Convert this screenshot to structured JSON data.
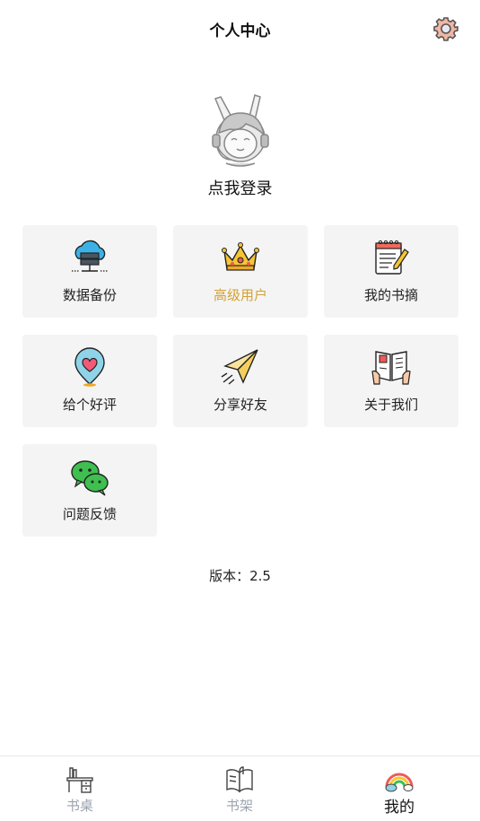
{
  "header": {
    "title": "个人中心",
    "settings_icon": "gear-icon"
  },
  "profile": {
    "login_text": "点我登录",
    "avatar_icon": "cartoon-avatar"
  },
  "menu": {
    "items": [
      {
        "label": "数据备份",
        "icon": "cloud-server-icon"
      },
      {
        "label": "高级用户",
        "icon": "crown-icon",
        "color": "#d4a133"
      },
      {
        "label": "我的书摘",
        "icon": "notepad-pencil-icon"
      },
      {
        "label": "给个好评",
        "icon": "heart-pin-icon"
      },
      {
        "label": "分享好友",
        "icon": "paper-plane-icon"
      },
      {
        "label": "关于我们",
        "icon": "open-book-hands-icon"
      },
      {
        "label": "问题反馈",
        "icon": "wechat-icon"
      }
    ]
  },
  "footer": {
    "version": "版本：2.5"
  },
  "tabbar": {
    "tabs": [
      {
        "label": "书桌",
        "icon": "desk-icon",
        "active": false
      },
      {
        "label": "书架",
        "icon": "open-book-icon",
        "active": false
      },
      {
        "label": "我的",
        "icon": "rainbow-icon",
        "active": true
      }
    ]
  }
}
